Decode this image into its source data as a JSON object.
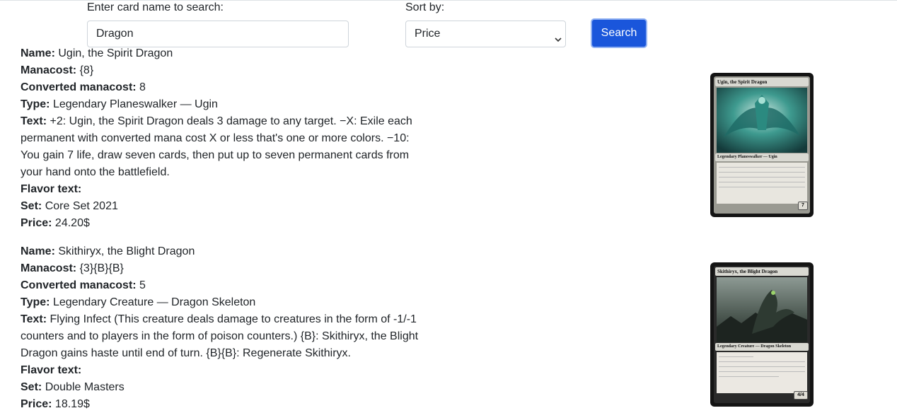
{
  "search": {
    "label": "Enter card name to search:",
    "value": "Dragon",
    "placeholder": ""
  },
  "sort": {
    "label": "Sort by:",
    "selected": "Price"
  },
  "search_button": "Search",
  "field_labels": {
    "name": "Name:",
    "manacost": "Manacost:",
    "cmc": "Converted manacost:",
    "type": "Type:",
    "text": "Text:",
    "flavor": "Flavor text:",
    "set": "Set:",
    "price": "Price:"
  },
  "cards": [
    {
      "name": "Ugin, the Spirit Dragon",
      "manacost": "{8}",
      "cmc": "8",
      "type": "Legendary Planeswalker — Ugin",
      "text": "+2: Ugin, the Spirit Dragon deals 3 damage to any target. −X: Exile each permanent with converted mana cost X or less that's one or more colors. −10: You gain 7 life, draw seven cards, then put up to seven permanent cards from your hand onto the battlefield.",
      "flavor": "",
      "set": "Core Set 2021",
      "price": "24.20$",
      "image": {
        "title": "Ugin, the Spirit Dragon",
        "type_line": "Legendary Planeswalker — Ugin",
        "corner": "7",
        "frame_color": "#9a9a92",
        "art_color": "#2f7f78"
      }
    },
    {
      "name": "Skithiryx, the Blight Dragon",
      "manacost": "{3}{B}{B}",
      "cmc": "5",
      "type": "Legendary Creature — Dragon Skeleton",
      "text": "Flying Infect (This creature deals damage to creatures in the form of -1/-1 counters and to players in the form of poison counters.) {B}: Skithiryx, the Blight Dragon gains haste until end of turn. {B}{B}: Regenerate Skithiryx.",
      "flavor": "",
      "set": "Double Masters",
      "price": "18.19$",
      "image": {
        "title": "Skithiryx, the Blight Dragon",
        "type_line": "Legendary Creature — Dragon Skeleton",
        "corner": "4/4",
        "frame_color": "#2a2a2a",
        "art_color": "#5b6a5e"
      }
    }
  ]
}
